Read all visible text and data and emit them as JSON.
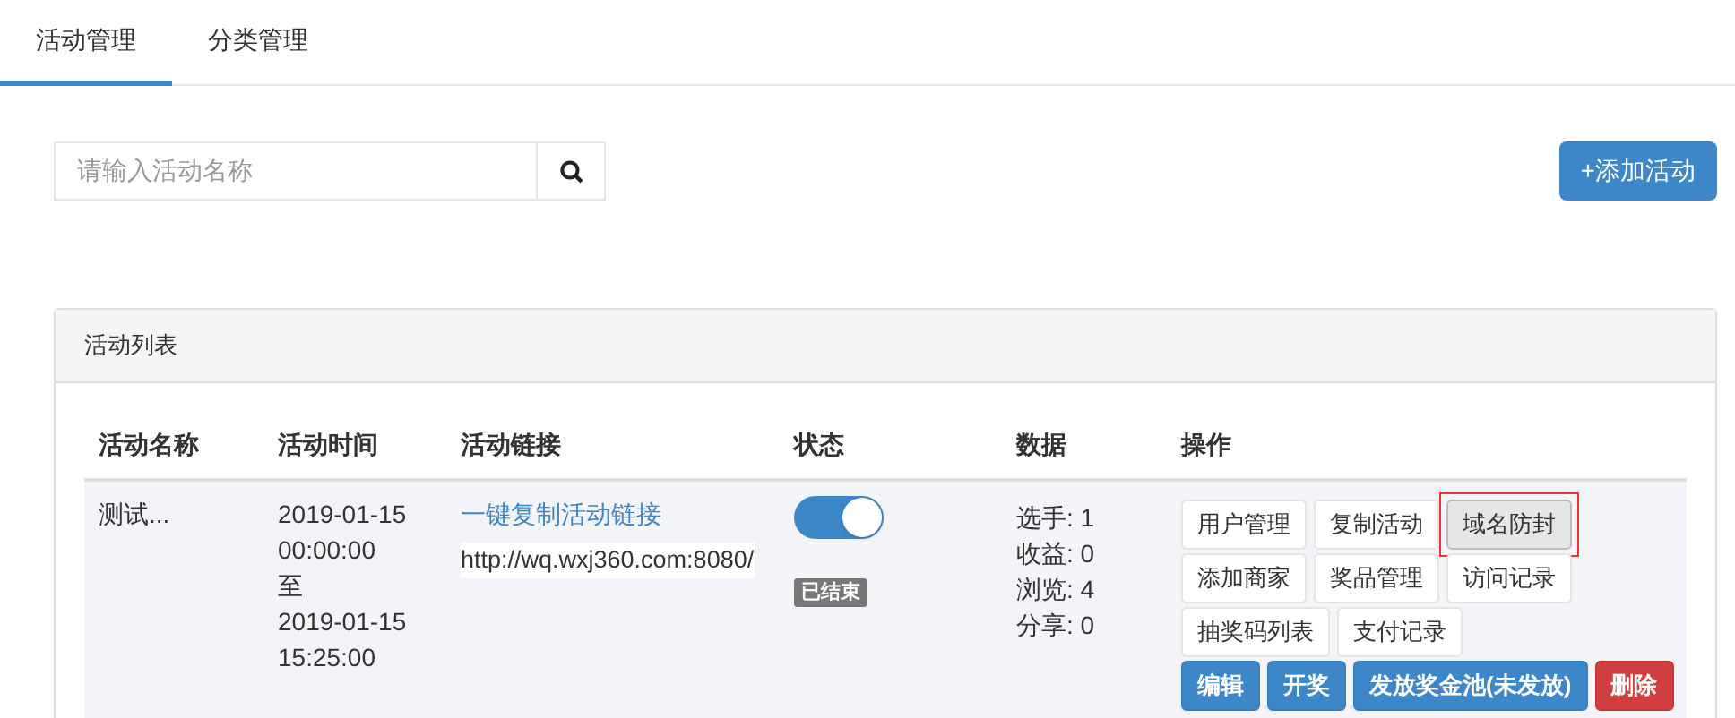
{
  "tabs": [
    {
      "label": "活动管理",
      "selected": true
    },
    {
      "label": "分类管理",
      "selected": false
    }
  ],
  "search": {
    "placeholder": "请输入活动名称"
  },
  "add_button": "+添加活动",
  "panel": {
    "title": "活动列表",
    "columns": [
      "活动名称",
      "活动时间",
      "活动链接",
      "状态",
      "数据",
      "操作"
    ],
    "rows": [
      {
        "name": "测试...",
        "time": [
          "2019-01-15",
          "00:00:00",
          "至",
          "2019-01-15",
          "15:25:00"
        ],
        "copy_link": "一键复制活动链接",
        "url": "http://wq.wxj360.com:8080/",
        "on": true,
        "status": "已结束",
        "stats": [
          "选手: 1",
          "收益: 0",
          "浏览: 4",
          "分享: 0"
        ],
        "actions": [
          [
            {
              "label": "用户管理",
              "kind": "default",
              "highlighted": false
            },
            {
              "label": "复制活动",
              "kind": "default",
              "highlighted": false
            },
            {
              "label": "域名防封",
              "kind": "default",
              "highlighted": true
            }
          ],
          [
            {
              "label": "添加商家",
              "kind": "default",
              "highlighted": false
            },
            {
              "label": "奖品管理",
              "kind": "default",
              "highlighted": false
            },
            {
              "label": "访问记录",
              "kind": "default",
              "highlighted": false
            }
          ],
          [
            {
              "label": "抽奖码列表",
              "kind": "default",
              "highlighted": false
            },
            {
              "label": "支付记录",
              "kind": "default",
              "highlighted": false
            }
          ],
          [
            {
              "label": "编辑",
              "kind": "primary",
              "highlighted": false
            },
            {
              "label": "开奖",
              "kind": "primary",
              "highlighted": false
            },
            {
              "label": "发放奖金池(未发放)",
              "kind": "primary",
              "highlighted": false
            },
            {
              "label": "删除",
              "kind": "danger",
              "highlighted": false
            }
          ]
        ]
      }
    ]
  }
}
